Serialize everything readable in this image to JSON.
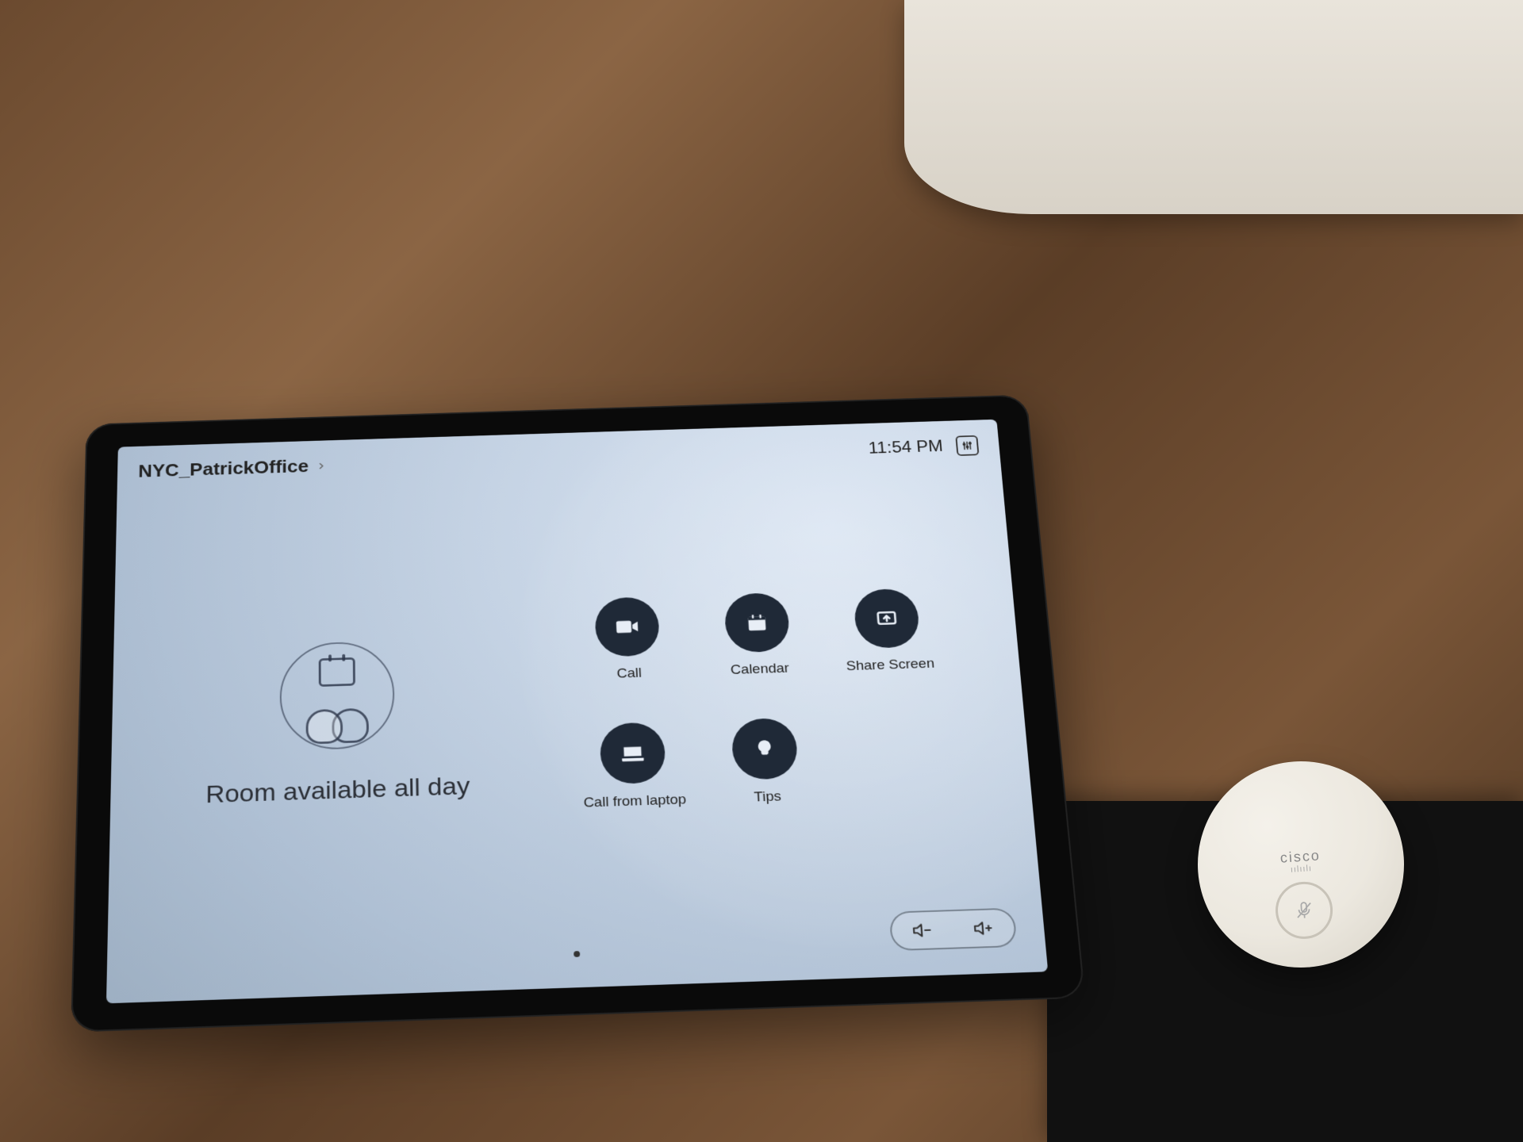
{
  "room": {
    "name": "NYC_PatrickOffice"
  },
  "clock": {
    "time": "11:54 PM"
  },
  "status": {
    "message": "Room available all day"
  },
  "actions": {
    "call": "Call",
    "calendar": "Calendar",
    "share_screen": "Share Screen",
    "call_from_laptop": "Call from laptop",
    "tips": "Tips"
  },
  "peripherals": {
    "mic_brand": "cisco"
  }
}
